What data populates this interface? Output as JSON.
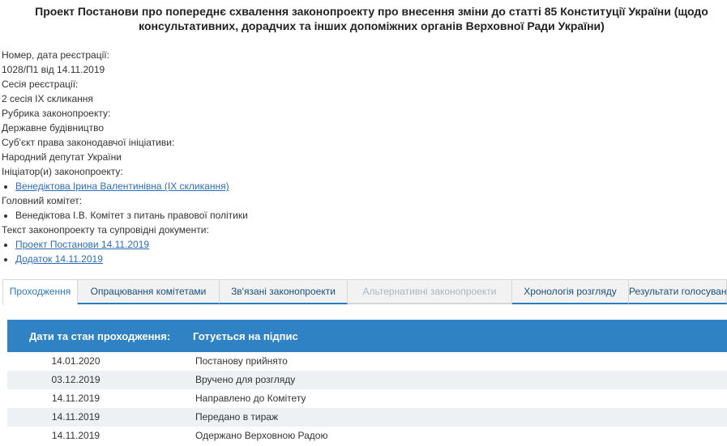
{
  "title": "Проект Постанови про попереднє схвалення законопроекту про внесення зміни до статті 85 Конституції України (щодо консультативних, дорадчих та інших допоміжних органів Верховної Ради України)",
  "info": {
    "reg_label": "Номер, дата реєстрації:",
    "reg_value": "1028/П1 від 14.11.2019",
    "session_label": "Сесія реєстрації:",
    "session_value": "2 сесія IX скликання",
    "rubric_label": "Рубрика законопроекту:",
    "rubric_value": "Державне будівництво",
    "subject_label": "Суб'єкт права законодавчої ініціативи:",
    "subject_value": "Народний депутат України",
    "initiator_label": "Ініціатор(и) законопроекту:",
    "initiator_link": "Венедіктова Ірина Валентинівна (IX скликання)",
    "committee_label": "Головний комітет:",
    "committee_value": "Венедіктова І.В. Комітет з питань правової політики",
    "docs_label": "Текст законопроекту та супровідні документи:",
    "docs": [
      "Проект Постанови 14.11.2019",
      "Додаток 14.11.2019"
    ]
  },
  "tabs": [
    {
      "label": "Проходження",
      "state": "active"
    },
    {
      "label": "Опрацювання комітетами",
      "state": "normal"
    },
    {
      "label": "Зв'язані законопроекти",
      "state": "normal"
    },
    {
      "label": "Альтернативні законопроекти",
      "state": "disabled"
    },
    {
      "label": "Хронологія розгляду",
      "state": "normal"
    },
    {
      "label": "Результати голосування",
      "state": "normal"
    }
  ],
  "table": {
    "head_dates": "Дати та стан проходження:",
    "head_status": "Готується на підпис",
    "rows": [
      {
        "date": "14.01.2020",
        "status": "Постанову прийнято"
      },
      {
        "date": "03.12.2019",
        "status": "Вручено для розгляду"
      },
      {
        "date": "14.11.2019",
        "status": "Направлено до Комітету"
      },
      {
        "date": "14.11.2019",
        "status": "Передано в тираж"
      },
      {
        "date": "14.11.2019",
        "status": "Одержано Верховною Радою"
      }
    ]
  },
  "colors": {
    "accent": "#2f82c4",
    "link": "#2a6ebb"
  }
}
